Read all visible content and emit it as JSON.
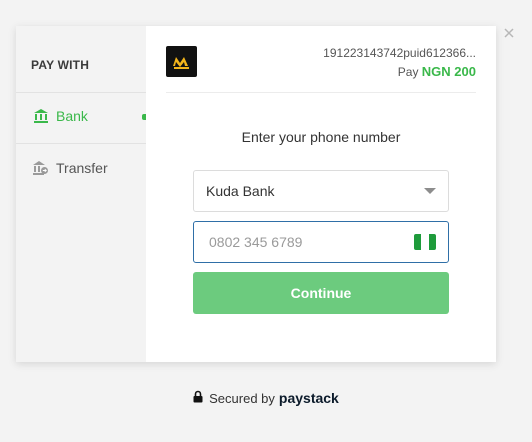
{
  "close": {
    "icon": "close-icon"
  },
  "sidebar": {
    "title": "PAY WITH",
    "items": [
      {
        "label": "Bank",
        "icon": "bank-icon",
        "active": true
      },
      {
        "label": "Transfer",
        "icon": "transfer-icon",
        "active": false
      }
    ]
  },
  "header": {
    "logo_icon": "merchant-logo",
    "merchant_id": "191223143742puid612366...",
    "pay_prefix": "Pay",
    "amount": "NGN 200"
  },
  "form": {
    "heading": "Enter your phone number",
    "bank_value": "Kuda Bank",
    "phone_placeholder": "0802 345 6789",
    "continue_label": "Continue"
  },
  "footer": {
    "secured_text": "Secured by",
    "brand": "paystack"
  },
  "colors": {
    "accent": "#3ab84a",
    "button": "#6ccb7e",
    "input_focus": "#2f6fa7"
  }
}
